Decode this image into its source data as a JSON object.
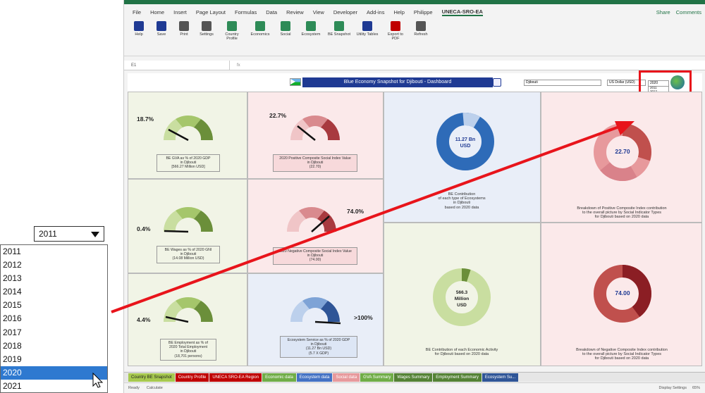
{
  "ribbon_menu": [
    "File",
    "Home",
    "Insert",
    "Page Layout",
    "Formulas",
    "Data",
    "Review",
    "View",
    "Developer",
    "Add-ins",
    "Help",
    "Philippe",
    "UNECA-SRO-EA"
  ],
  "menu_right": {
    "share": "Share",
    "comments": "Comments"
  },
  "ribbon_buttons": [
    "Help",
    "Save",
    "Print",
    "Settings",
    "Country Profile",
    "Economics",
    "Social",
    "Ecosystem",
    "BE Snapshot",
    "Utility Tables",
    "Export to PDF",
    "Refresh"
  ],
  "name_box": "E1",
  "fx": "fx",
  "dashboard": {
    "title": "Blue Economy Snapshot for Djibouti - Dashboard",
    "country_dd": "Djibouti",
    "unit_dd": "US Dollar (USD)",
    "year_dd": "2020",
    "mini_years": [
      "2011",
      "2012",
      "2013",
      "2014",
      "2015",
      "2016",
      "2017",
      "2018",
      "2019",
      "2020",
      "2021"
    ]
  },
  "gauges": {
    "g1": {
      "pct": "18.7%",
      "cap1": "BE GVA as % of 2020 GDP",
      "cap2": "in Djibouti",
      "cap3": "[566.27 Million USD]"
    },
    "g2": {
      "pct": "22.7%",
      "cap1": "2020 Positive Composite Social Index Value",
      "cap2": "in Djibouti",
      "cap3": "(22.70)"
    },
    "g3": {
      "pct": "0.4%",
      "cap1": "BE Wages as % of 2020 GNI",
      "cap2": "in Djibouti",
      "cap3": "(14.08 Million USD)"
    },
    "g4": {
      "pct": "74.0%",
      "cap1": "2020 Negative Composite Social Index Value",
      "cap2": "in Djibouti",
      "cap3": "(74.00)"
    },
    "g5": {
      "pct": "4.4%",
      "cap1": "BE Employment as % of",
      "cap2": "2020 Total Employment",
      "cap3": "in Djibouti",
      "cap4": "(18,701 persons)"
    },
    "g6": {
      "pct": ">100%",
      "cap1": "Ecosystem Service as % of 2020 GDP",
      "cap2": "in Djibouti",
      "cap3": "(11.27 Bn USD)",
      "cap4": "(5.7 X GDP)"
    },
    "ticks": {
      "t0": "0%",
      "t25": "25%",
      "t50": "50%",
      "t75": "75%",
      "t100": "100%"
    }
  },
  "donuts": {
    "d1": {
      "center1": "11.27 Bn",
      "center2": "USD",
      "cap1": "BE Contribution",
      "cap2": "of each type of Ecosystems",
      "cap3": "in Djibouti",
      "cap4": "based on 2020 data"
    },
    "d2": {
      "center": "22.70",
      "cap1": "Breakdown of Positive Composite Index contribution",
      "cap2": "to the overall picture by Social Indicator Types",
      "cap3": "for Djibouti based on 2020 data"
    },
    "d3": {
      "center1": "566.3",
      "center2": "Million",
      "center3": "USD",
      "cap1": "BE Contribution of each Economic Activity",
      "cap2": "for Djibouti based on 2020 data"
    },
    "d4": {
      "center": "74.00",
      "cap1": "Breakdown of Negative Composite Index contribution",
      "cap2": "to the overall picture by Social Indicator Types",
      "cap3": "for Djibouti based on 2020 data"
    }
  },
  "sheet_tabs": [
    "Country BE Snapshot",
    "Country Profile",
    "UNECA SRO-EA Region",
    "Economic data",
    "Ecosystem data",
    "Social data",
    "GVA Summary",
    "Wages Summary",
    "Employment Summary",
    "Ecosystem Su..."
  ],
  "tab_colors": [
    "#a7c94f",
    "#c00000",
    "#c00000",
    "#70ad47",
    "#4472c4",
    "#e7999c",
    "#70ad47",
    "#548235",
    "#548235",
    "#2f5597"
  ],
  "status": {
    "ready": "Ready",
    "calc": "Calculate",
    "display": "Display Settings",
    "zoom": "65%"
  },
  "dropdown": {
    "value": "2011"
  },
  "year_list": [
    "2011",
    "2012",
    "2013",
    "2014",
    "2015",
    "2016",
    "2017",
    "2018",
    "2019",
    "2020",
    "2021"
  ],
  "selected_year": "2020"
}
